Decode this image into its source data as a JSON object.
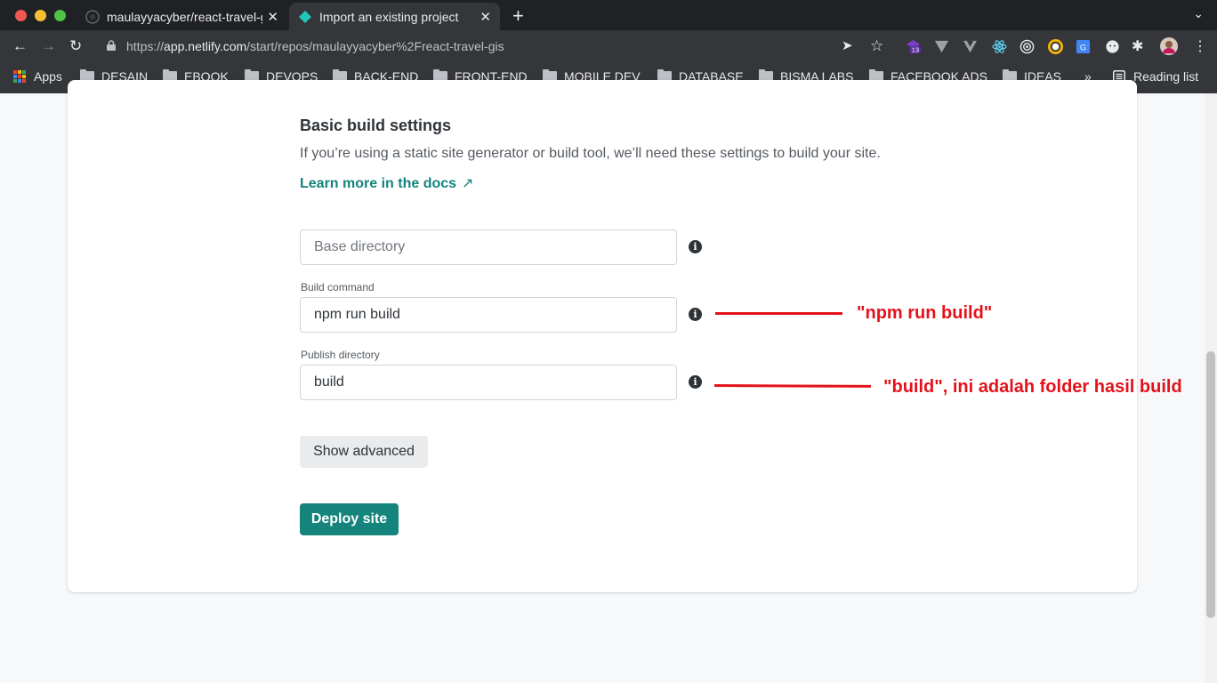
{
  "browser": {
    "tabs": [
      {
        "title": "maulayyacyber/react-travel-gis",
        "active": false
      },
      {
        "title": "Import an existing project",
        "active": true
      }
    ],
    "url_prefix": "https://",
    "url_host": "app.netlify.com",
    "url_path": "/start/repos/maulayyacyber%2Freact-travel-gis",
    "extension_badge": "13"
  },
  "bookmarks": {
    "apps_label": "Apps",
    "folders": [
      "DESAIN",
      "EBOOK",
      "DEVOPS",
      "BACK-END",
      "FRONT-END",
      "MOBILE DEV",
      "DATABASE",
      "BISMA LABS",
      "FACEBOOK ADS",
      "IDEAS"
    ],
    "more": "»",
    "reading_list": "Reading list"
  },
  "page": {
    "title": "Basic build settings",
    "description": "If you’re using a static site generator or build tool, we’ll need these settings to build your site.",
    "docs_link": "Learn more in the docs",
    "base_directory": {
      "placeholder": "Base directory",
      "value": ""
    },
    "build_command": {
      "label": "Build command",
      "value": "npm run build"
    },
    "publish_directory": {
      "label": "Publish directory",
      "value": "build"
    },
    "show_advanced": "Show advanced",
    "deploy": "Deploy site"
  },
  "annotations": {
    "build_command_note": "\"npm run build\"",
    "publish_directory_note": "\"build\", ini adalah folder hasil build",
    "color": "#e3121b"
  },
  "colors": {
    "accent": "#15847d",
    "link": "#14837c"
  }
}
